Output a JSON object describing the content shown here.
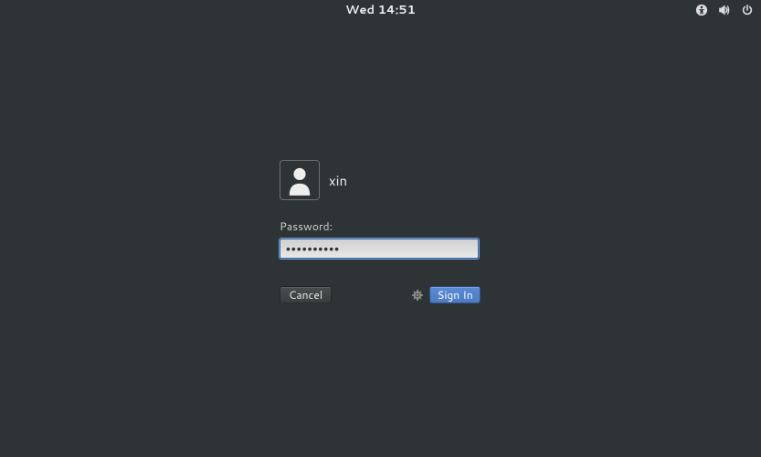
{
  "topbar": {
    "clock": "Wed 14:51"
  },
  "login": {
    "username": "xin",
    "password_label": "Password:",
    "password_value": "••••••••••"
  },
  "buttons": {
    "cancel": "Cancel",
    "signin": "Sign In"
  }
}
